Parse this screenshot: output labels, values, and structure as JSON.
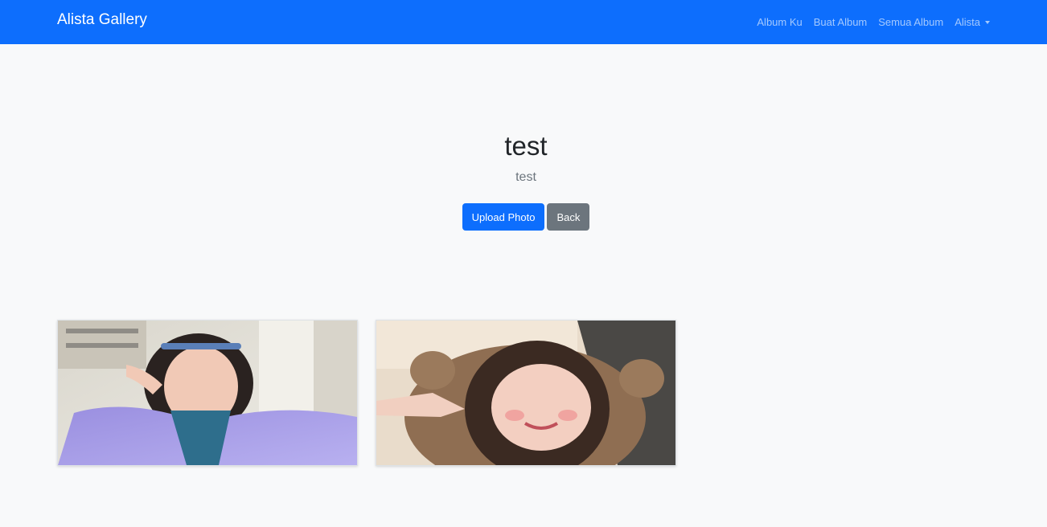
{
  "navbar": {
    "brand": "Alista Gallery",
    "links": [
      {
        "label": "Album Ku"
      },
      {
        "label": "Buat Album"
      },
      {
        "label": "Semua Album"
      }
    ],
    "user_menu": "Alista",
    "color": "#0d6efd"
  },
  "album": {
    "title": "test",
    "description": "test",
    "upload_label": "Upload Photo",
    "back_label": "Back"
  },
  "photos": [
    {
      "icon": "photo-thumbnail"
    },
    {
      "icon": "photo-thumbnail"
    }
  ]
}
